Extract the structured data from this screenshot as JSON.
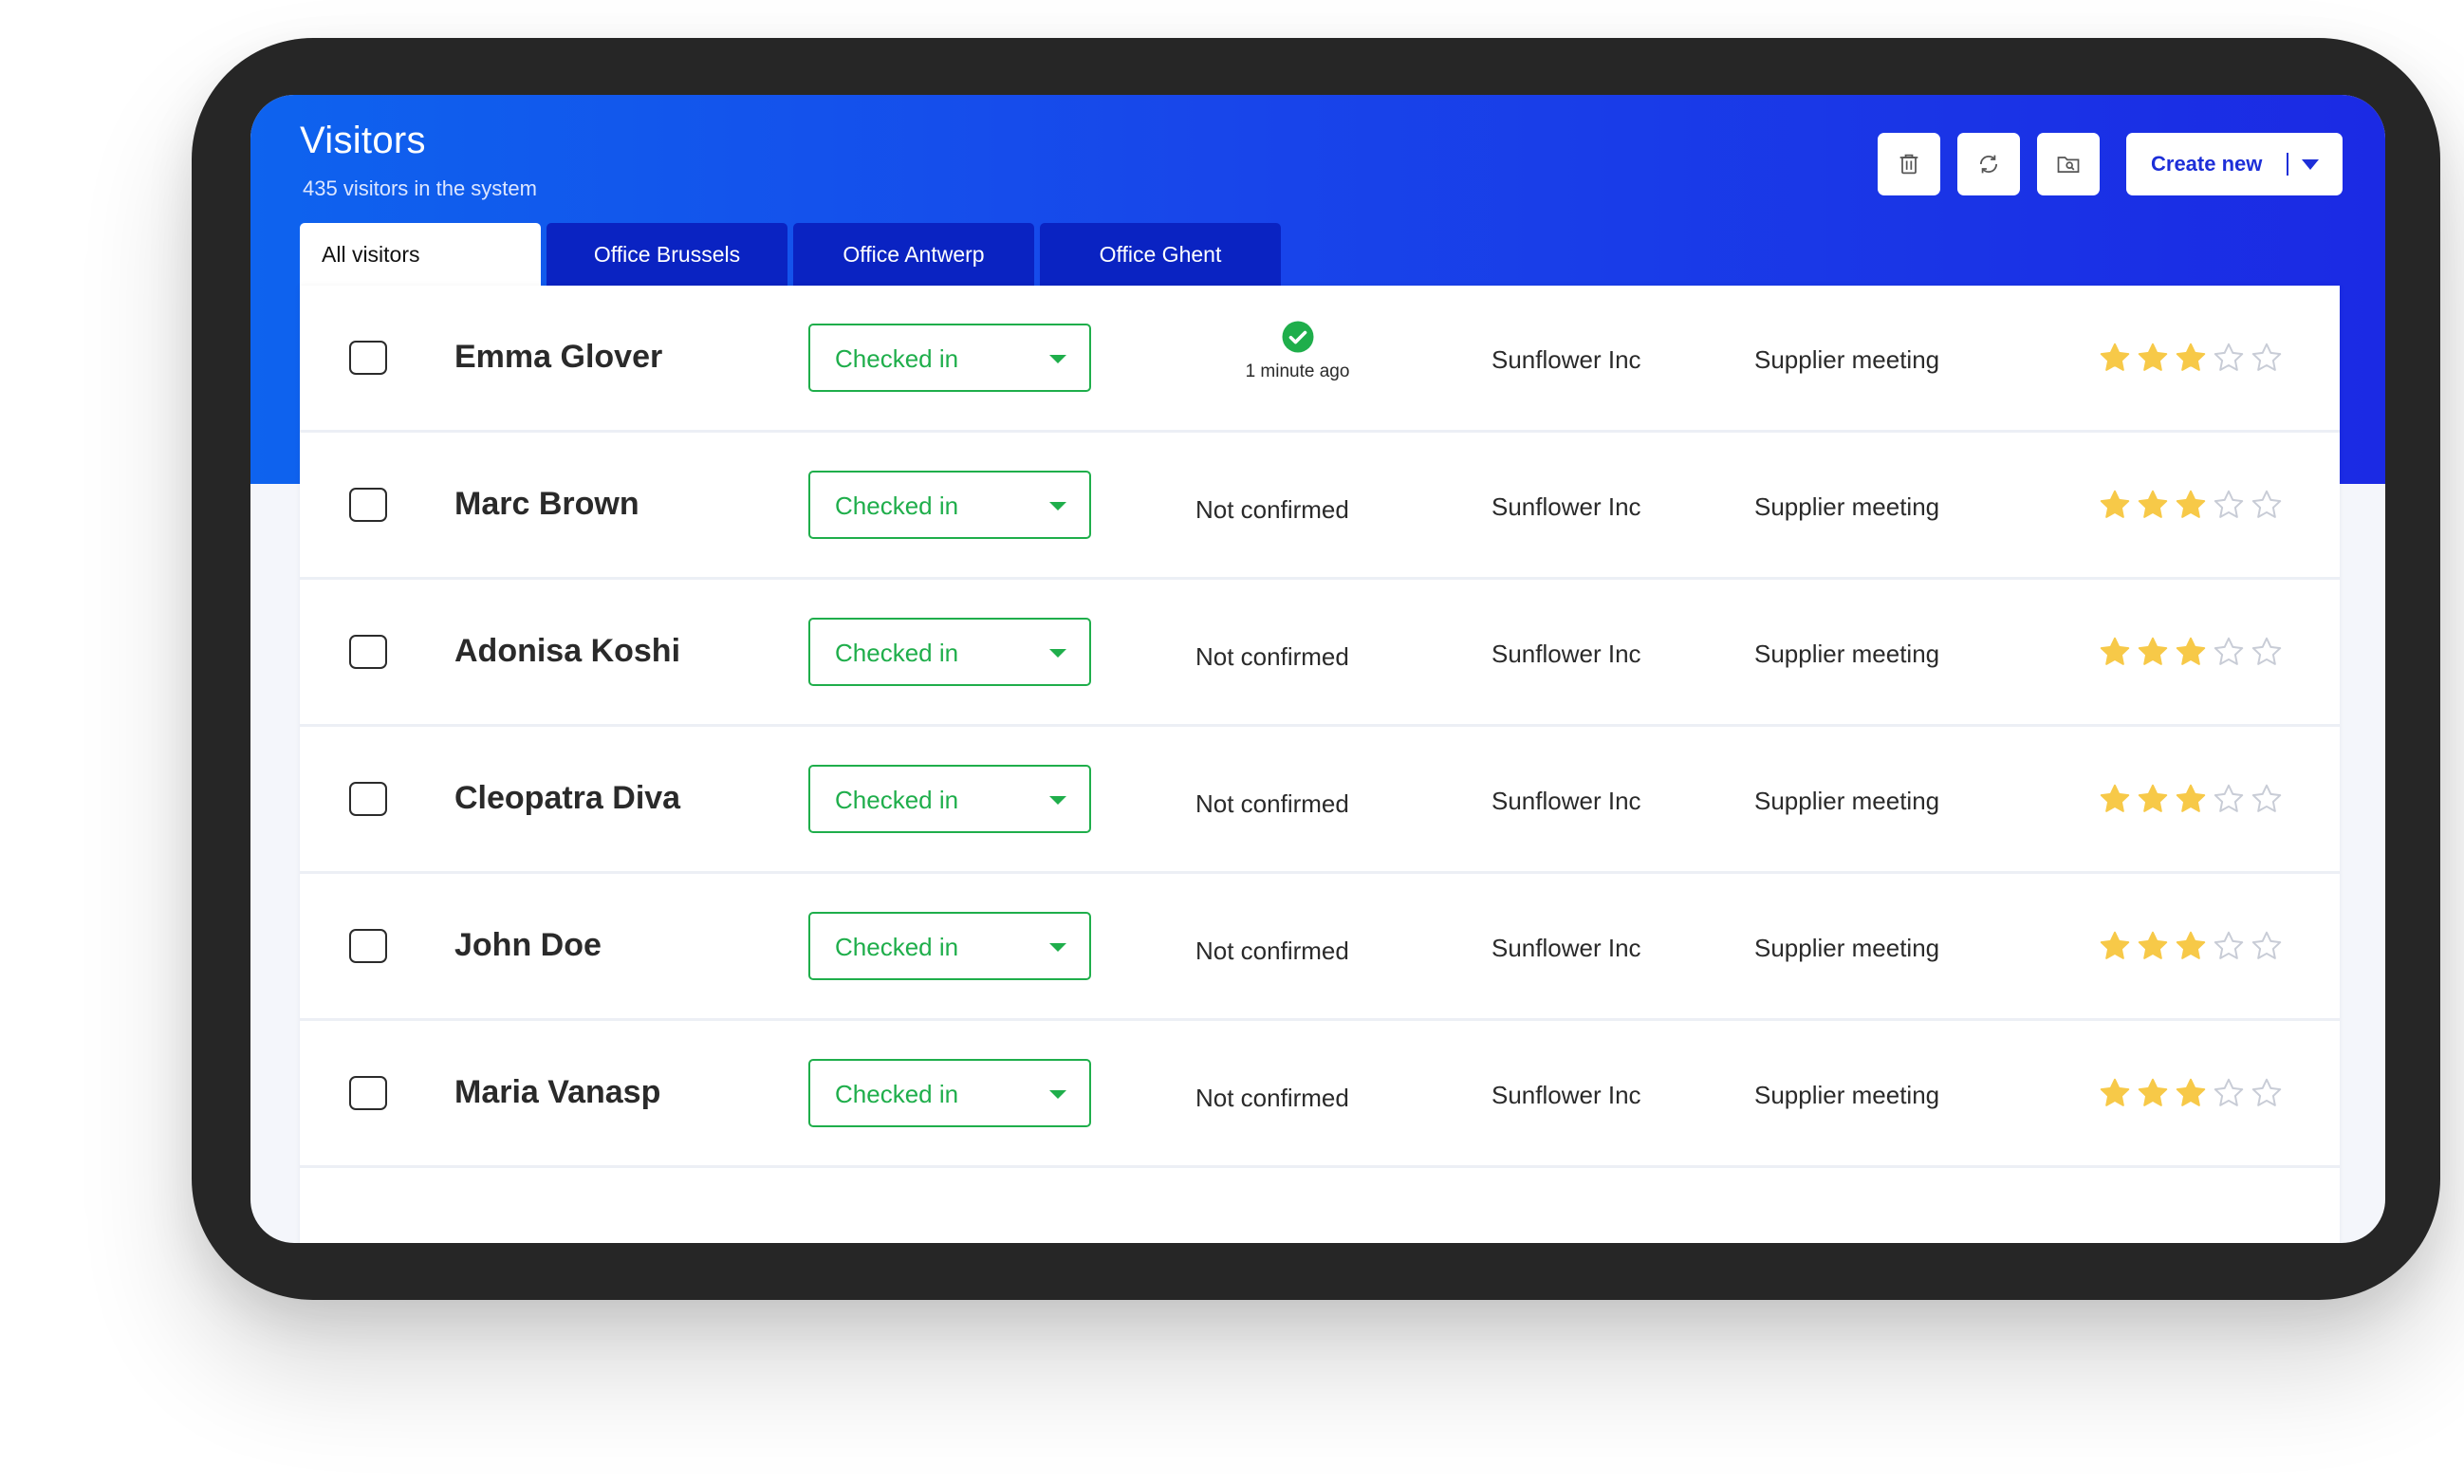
{
  "header": {
    "title": "Visitors",
    "subtitle": "435 visitors in the system",
    "create_label": "Create new"
  },
  "toolbar": {
    "buttons": [
      {
        "name": "delete-button",
        "icon": "trash-icon"
      },
      {
        "name": "refresh-button",
        "icon": "refresh-icon"
      },
      {
        "name": "folder-button",
        "icon": "folder-icon"
      }
    ]
  },
  "tabs": [
    {
      "label": "All visitors",
      "active": true
    },
    {
      "label": "Office Brussels",
      "active": false
    },
    {
      "label": "Office Antwerp",
      "active": false
    },
    {
      "label": "Office Ghent",
      "active": false
    }
  ],
  "colors": {
    "accent": "#1d2fd8",
    "tab_bg": "#0a23c2",
    "status_green": "#1fae4b",
    "star_filled": "#f7c948",
    "star_empty": "#c8ccd6"
  },
  "rows": [
    {
      "name": "Emma Glover",
      "status": "Checked in",
      "confirmed": true,
      "confirm_time": "1 minute ago",
      "company": "Sunflower Inc",
      "purpose": "Supplier meeting",
      "rating": 3,
      "max_rating": 5
    },
    {
      "name": "Marc Brown",
      "status": "Checked in",
      "confirmed": false,
      "confirm_text": "Not confirmed",
      "company": "Sunflower Inc",
      "purpose": "Supplier meeting",
      "rating": 3,
      "max_rating": 5
    },
    {
      "name": "Adonisa Koshi",
      "status": "Checked in",
      "confirmed": false,
      "confirm_text": "Not confirmed",
      "company": "Sunflower Inc",
      "purpose": "Supplier meeting",
      "rating": 3,
      "max_rating": 5
    },
    {
      "name": "Cleopatra Diva",
      "status": "Checked in",
      "confirmed": false,
      "confirm_text": "Not confirmed",
      "company": "Sunflower Inc",
      "purpose": "Supplier meeting",
      "rating": 3,
      "max_rating": 5
    },
    {
      "name": "John Doe",
      "status": "Checked in",
      "confirmed": false,
      "confirm_text": "Not confirmed",
      "company": "Sunflower Inc",
      "purpose": "Supplier meeting",
      "rating": 3,
      "max_rating": 5
    },
    {
      "name": "Maria Vanasp",
      "status": "Checked in",
      "confirmed": false,
      "confirm_text": "Not confirmed",
      "company": "Sunflower Inc",
      "purpose": "Supplier meeting",
      "rating": 3,
      "max_rating": 5
    }
  ]
}
